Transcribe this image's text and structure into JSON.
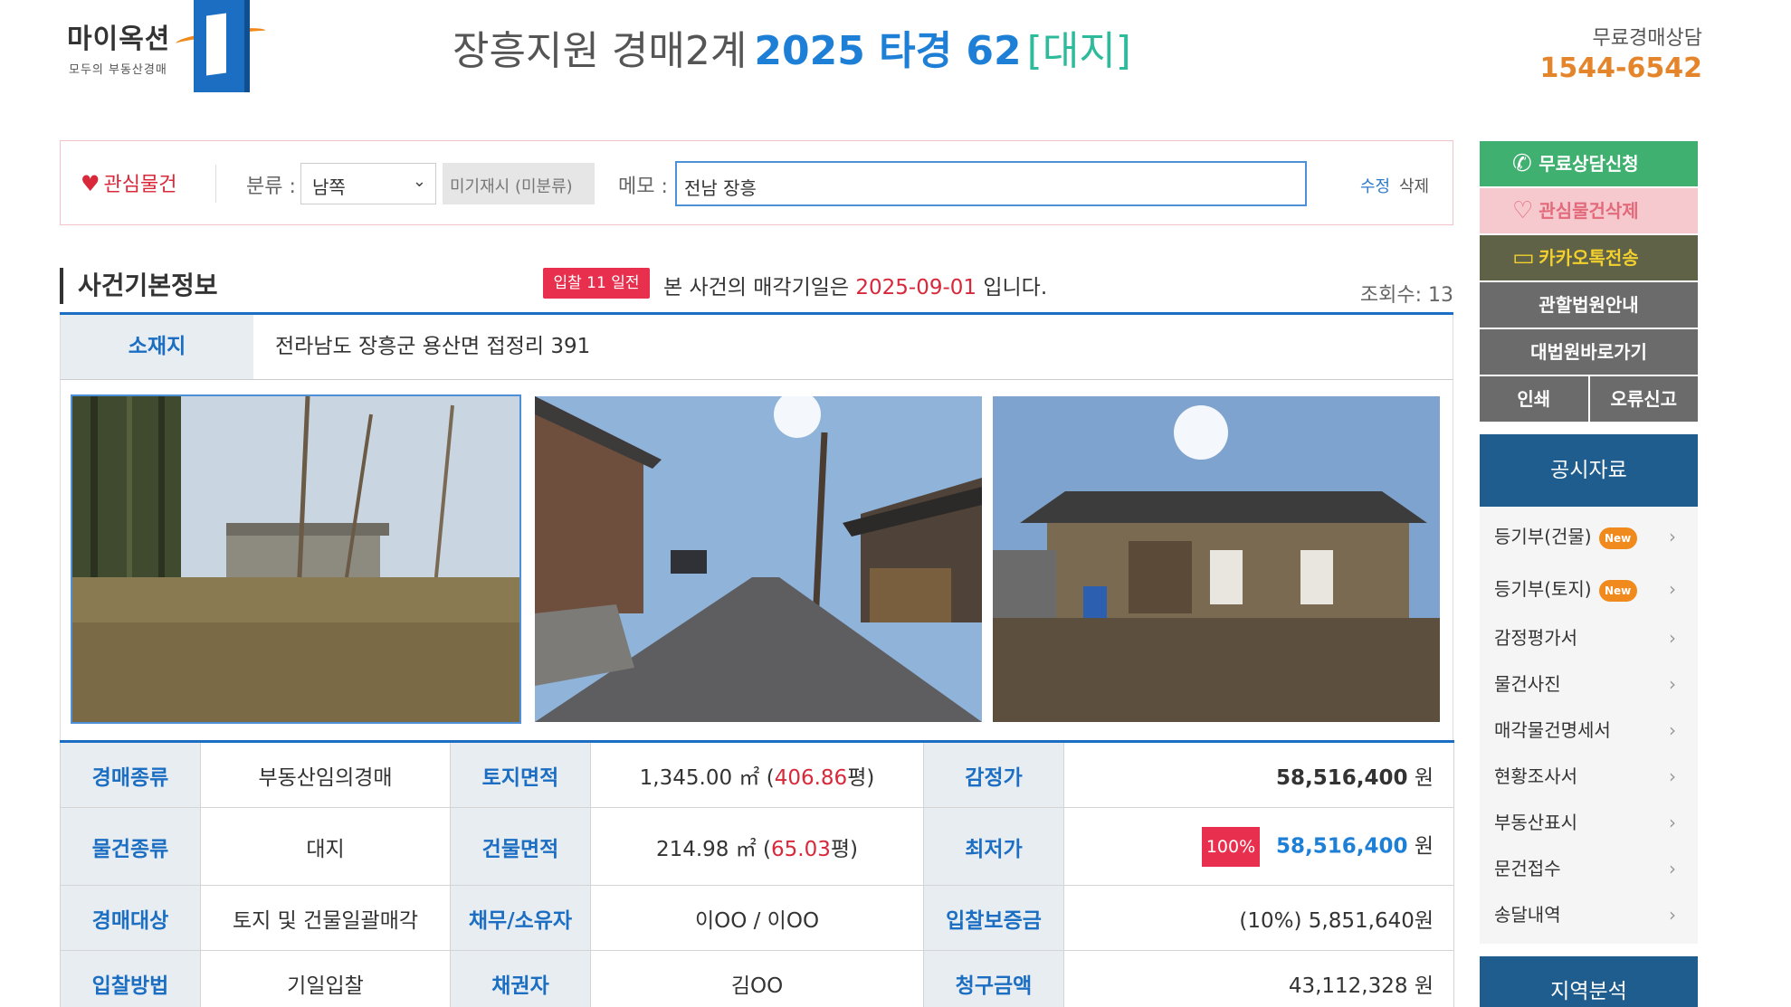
{
  "header": {
    "logo_text": "마이옥션",
    "logo_sub": "모두의 부동산경매",
    "court": "장흥지원 경매2계",
    "case_id": "2025 타경 62",
    "property_tag": "[대지]",
    "consult_label": "무료경매상담",
    "consult_phone": "1544-6542"
  },
  "interest_bar": {
    "heart_label": "관심물건",
    "category_label": "분류 :",
    "category_value": "남쪽",
    "unclassified": "미기재시 (미분류)",
    "memo_label": "메모 :",
    "memo_value": "전남 장흥",
    "edit": "수정",
    "delete": "삭제"
  },
  "section": {
    "title": "사건기본정보",
    "bid_badge": "입찰 11 일전",
    "notice_prefix": "본 사건의 매각기일은",
    "sale_date": "2025-09-01",
    "notice_suffix": "입니다.",
    "views": "조회수: 13"
  },
  "location": {
    "label": "소재지",
    "value": "전라남도 장흥군 용산면 접정리 391"
  },
  "info": {
    "auction_type_label": "경매종류",
    "auction_type": "부동산임의경매",
    "land_area_label": "토지면적",
    "land_area_m2": "1,345.00 ㎡ (",
    "land_area_py": "406.86",
    "land_area_unit": "평)",
    "appraisal_label": "감정가",
    "appraisal_value": "58,516,400",
    "won": "원",
    "property_type_label": "물건종류",
    "property_type": "대지",
    "building_area_label": "건물면적",
    "building_area_m2": "214.98 ㎡ (",
    "building_area_py": "65.03",
    "building_area_unit": "평)",
    "min_price_label": "최저가",
    "min_price_pct": "100%",
    "min_price_value": "58,516,400",
    "target_label": "경매대상",
    "target": "토지 및 건물일괄매각",
    "debtor_label": "채무/소유자",
    "debtor": "이OO / 이OO",
    "deposit_label": "입찰보증금",
    "deposit": "(10%) 5,851,640원",
    "bid_method_label": "입찰방법",
    "bid_method": "기일입찰",
    "creditor_label": "채권자",
    "creditor": "김OO",
    "claim_label": "청구금액",
    "claim_value": "43,112,328"
  },
  "sidebar": {
    "consult_btn": "무료상담신청",
    "interest_delete_btn": "관심물건삭제",
    "kakao_btn": "카카오톡전송",
    "court_info_btn": "관할법원안내",
    "supreme_court_btn": "대법원바로가기",
    "print_btn": "인쇄",
    "error_btn": "오류신고",
    "public_docs_title": "공시자료",
    "public_docs": [
      {
        "label": "등기부(건물)",
        "new": "New"
      },
      {
        "label": "등기부(토지)",
        "new": "New"
      },
      {
        "label": "감정평가서"
      },
      {
        "label": "물건사진"
      },
      {
        "label": "매각물건명세서"
      },
      {
        "label": "현황조사서"
      },
      {
        "label": "부동산표시"
      },
      {
        "label": "문건접수"
      },
      {
        "label": "송달내역"
      }
    ],
    "region_title": "지역분석"
  },
  "colors": {
    "brand_blue": "#1b6ec2",
    "case_blue": "#1e7fd6",
    "accent_red": "#d8283a",
    "phone_orange": "#e5852b",
    "green": "#3fb06f",
    "navy": "#1f5d8f"
  }
}
